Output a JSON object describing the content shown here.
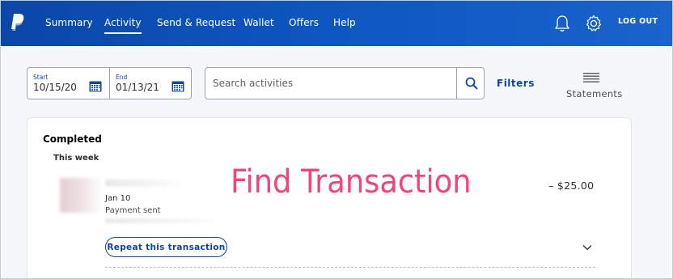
{
  "nav": {
    "items": [
      {
        "label": "Summary",
        "active": false
      },
      {
        "label": "Activity",
        "active": true
      },
      {
        "label": "Send & Request",
        "active": false
      },
      {
        "label": "Wallet",
        "active": false
      },
      {
        "label": "Offers",
        "active": false
      },
      {
        "label": "Help",
        "active": false
      }
    ],
    "logout_label": "LOG OUT",
    "icons": [
      "paypal-logo",
      "bell-icon",
      "gear-icon"
    ]
  },
  "date_range": {
    "start_label": "Start",
    "start_value": "10/15/20",
    "end_label": "End",
    "end_value": "01/13/21"
  },
  "search": {
    "placeholder": "Search activities",
    "value": ""
  },
  "filters_label": "Filters",
  "statements_label": "Statements",
  "activity": {
    "section_title": "Completed",
    "group_title": "This week",
    "transactions": [
      {
        "date": "Jan 10",
        "status": "Payment sent",
        "amount": "– $25.00",
        "repeat_label": "Repeat this transaction"
      }
    ]
  },
  "overlay_caption": "Find Transaction",
  "colors": {
    "nav_bg": "#0a47a8",
    "link": "#0a47a8",
    "overlay_text": "#f0457f"
  }
}
